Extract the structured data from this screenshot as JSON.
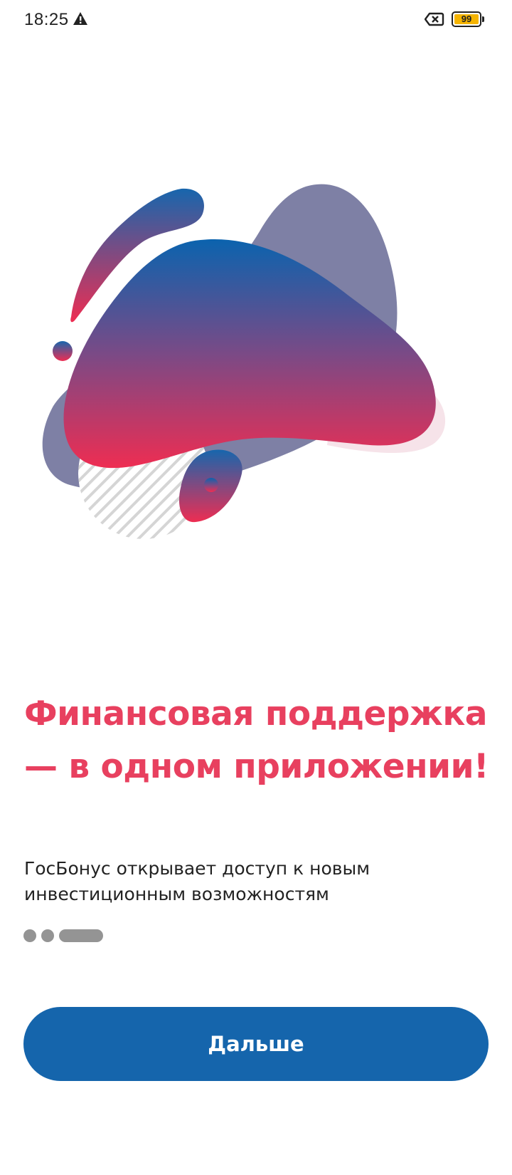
{
  "status_bar": {
    "time": "18:25",
    "battery_level": "99",
    "icons": [
      "warning-icon",
      "no-sim-icon",
      "battery-icon"
    ]
  },
  "onboarding": {
    "title": "Финансовая поддержка — в одном приложении!",
    "subtitle": "ГосБонус открывает доступ к новым инвестиционным возможностям",
    "page_indicator": {
      "total": 3,
      "current": 3
    },
    "next_button_label": "Дальше"
  },
  "colors": {
    "title": "#e8405f",
    "button": "#1565ac",
    "blob_top": "#0b63ae",
    "blob_bottom": "#ee2d52",
    "back_blob": "#7e80a5",
    "dots": "#949494"
  }
}
